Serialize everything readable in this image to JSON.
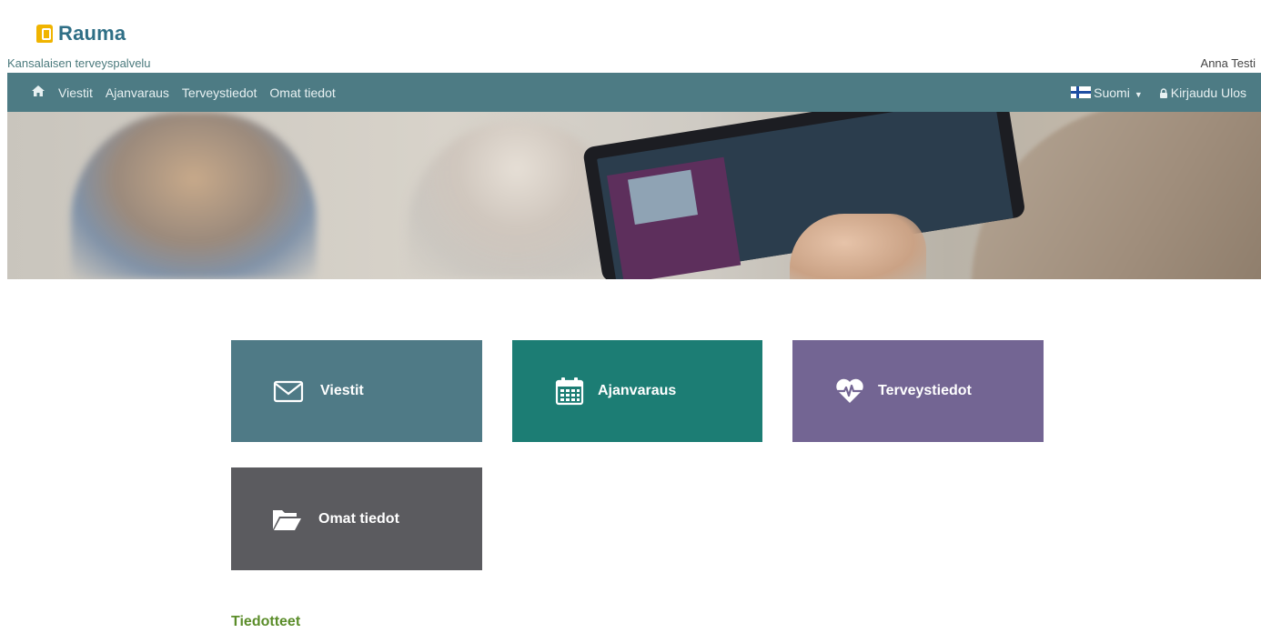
{
  "brand": {
    "logo_text": "Rauma",
    "subtitle": "Kansalaisen terveyspalvelu"
  },
  "user": {
    "name": "Anna Testi"
  },
  "nav": {
    "home_icon": "home-icon",
    "items": [
      {
        "label": "Viestit"
      },
      {
        "label": "Ajanvaraus"
      },
      {
        "label": "Terveystiedot"
      },
      {
        "label": "Omat tiedot"
      }
    ],
    "language": {
      "label": "Suomi",
      "icon": "finland-flag-icon"
    },
    "logout": {
      "label": "Kirjaudu Ulos",
      "icon": "lock-icon"
    }
  },
  "tiles": [
    {
      "label": "Viestit",
      "icon": "envelope-icon",
      "color": "#4f7a86"
    },
    {
      "label": "Ajanvaraus",
      "icon": "calendar-icon",
      "color": "#1c7d74"
    },
    {
      "label": "Terveystiedot",
      "icon": "heartbeat-icon",
      "color": "#736593"
    },
    {
      "label": "Omat tiedot",
      "icon": "folder-open-icon",
      "color": "#5b5b5f"
    }
  ],
  "section": {
    "title": "Tiedotteet"
  },
  "colors": {
    "navbar": "#4d7b84",
    "brand": "#2f6f86",
    "accent_green": "#5b8d2a",
    "logo_yellow": "#f0b400"
  }
}
